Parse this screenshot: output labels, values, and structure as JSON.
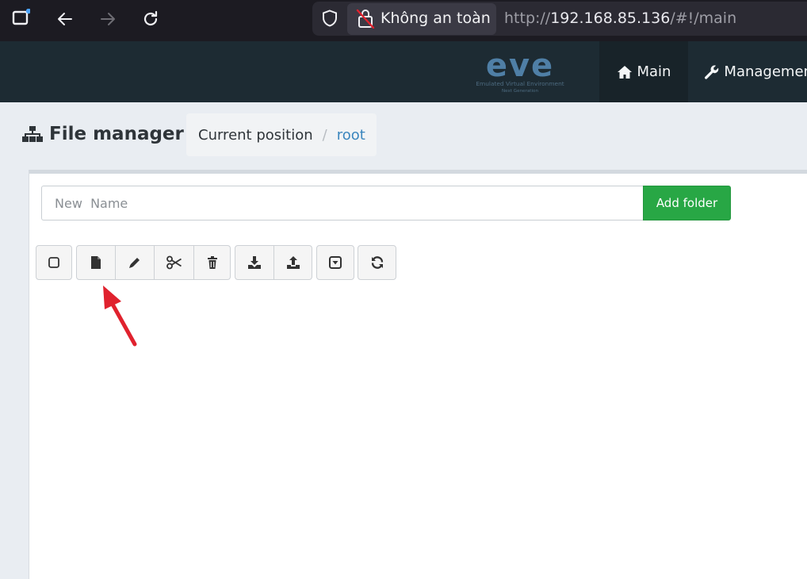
{
  "browser": {
    "security_label": "Không an toàn",
    "url_scheme": "http://",
    "url_host": "192.168.85.136",
    "url_path": "/#!/main"
  },
  "app_nav": {
    "logo": "eve",
    "logo_subtitle": "Emulated Virtual Environment",
    "logo_subtitle2": "Next Generation",
    "items": [
      {
        "label": "Main",
        "icon": "home-icon"
      },
      {
        "label": "Management",
        "icon": "wrench-icon"
      }
    ]
  },
  "page": {
    "title": "File manager",
    "breadcrumb": {
      "current": "Current position",
      "separator": "/",
      "root": "root"
    }
  },
  "folder_form": {
    "placeholder": "New  Name",
    "value": "",
    "add_label": "Add folder"
  },
  "toolbar": [
    {
      "name": "select-all",
      "icon": "checkbox-icon"
    },
    {
      "name": "new-file",
      "icon": "file-icon"
    },
    {
      "name": "rename",
      "icon": "pencil-icon"
    },
    {
      "name": "cut",
      "icon": "scissors-icon"
    },
    {
      "name": "delete",
      "icon": "trash-icon"
    },
    {
      "name": "export",
      "icon": "download-icon"
    },
    {
      "name": "import",
      "icon": "upload-icon"
    },
    {
      "name": "dropdown",
      "icon": "caret-box-icon"
    },
    {
      "name": "refresh",
      "icon": "refresh-icon"
    }
  ],
  "colors": {
    "browser_bg": "#1c1b22",
    "navbar_bg": "#1d2b33",
    "accent_green": "#28a745",
    "link_blue": "#3b86be",
    "annotation_red": "#e0222e"
  }
}
